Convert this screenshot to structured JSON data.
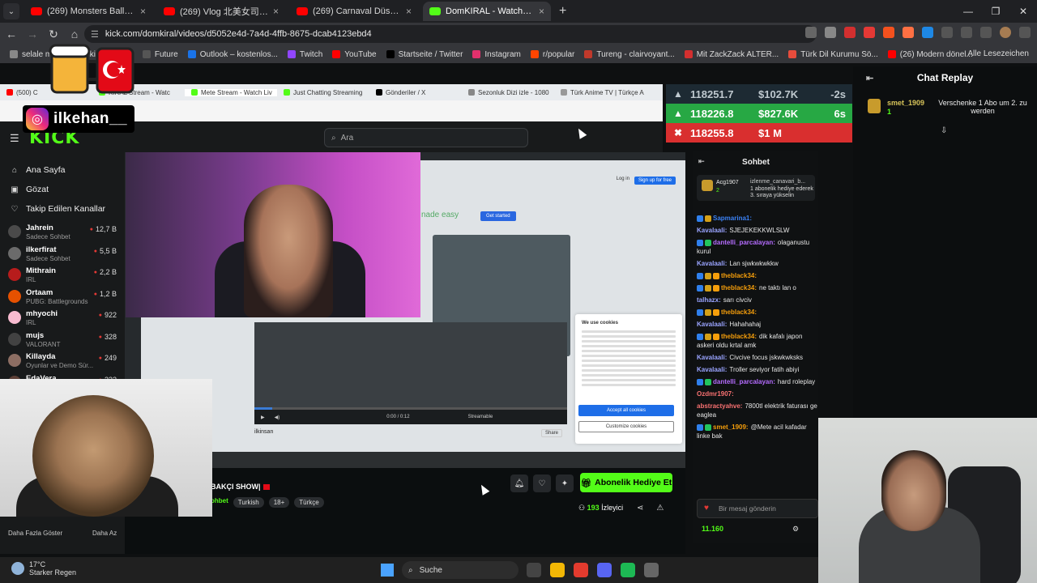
{
  "browser": {
    "tabs": [
      {
        "label": "(269) Monsters Ball: Bram vs. Al",
        "color": "#ff0000",
        "active": false
      },
      {
        "label": "(269) Vlog 北美女司机 工作＋生",
        "color": "#ff0000",
        "active": false
      },
      {
        "label": "(269) Carnaval Düsseldorf 2025",
        "color": "#ff0000",
        "active": false
      },
      {
        "label": "DomKIRAL - Watch the VO",
        "color": "#53fc18",
        "active": true
      }
    ],
    "url": "kick.com/domkiral/videos/d5052e4d-7a4d-4ffb-8675-dcab4123ebd4",
    "bookmarks": [
      {
        "label": "selale moruk",
        "color": "#888"
      },
      {
        "label": "ki",
        "color": "#555"
      },
      {
        "label": "idee",
        "color": "#555"
      },
      {
        "label": "Future",
        "color": "#555"
      },
      {
        "label": "Outlook – kostenlos...",
        "color": "#1a73e8"
      },
      {
        "label": "Twitch",
        "color": "#9146ff"
      },
      {
        "label": "YouTube",
        "color": "#ff0000"
      },
      {
        "label": "Startseite / Twitter",
        "color": "#000000"
      },
      {
        "label": "Instagram",
        "color": "#e1306c"
      },
      {
        "label": "r/popular",
        "color": "#ff4500"
      },
      {
        "label": "Tureng - clairvoyant...",
        "color": "#c0392b"
      },
      {
        "label": "Mit ZackZack ALTER...",
        "color": "#d32f2f"
      },
      {
        "label": "Türk Dil Kurumu Sö...",
        "color": "#e74c3c"
      },
      {
        "label": "(26) Modern dönel...",
        "color": "#ff0000"
      }
    ],
    "all_bookmarks": "Alle Lesezeichen"
  },
  "inner_browser": {
    "tabs": [
      {
        "label": "(500) C",
        "color": "#ff0000"
      },
      {
        "label": "KIRAL Stream - Watc",
        "color": "#53fc18"
      },
      {
        "label": "Mete Stream - Watch Liv",
        "color": "#53fc18"
      },
      {
        "label": "Just Chatting Streaming",
        "color": "#53fc18"
      },
      {
        "label": "Gönderiler / X",
        "color": "#000000"
      },
      {
        "label": "Sezonluk Dizi izle - 1080",
        "color": "#888888"
      },
      {
        "label": "Türk Anime TV | Türkçe A",
        "color": "#999999"
      }
    ]
  },
  "kick": {
    "logo": "KICK",
    "search_placeholder": "Ara",
    "nav": [
      {
        "label": "Ana Sayfa",
        "icon": "home-icon"
      },
      {
        "label": "Gözat",
        "icon": "browse-icon"
      },
      {
        "label": "Takip Edilen Kanallar",
        "icon": "heart-icon"
      }
    ],
    "channels": [
      {
        "name": "Jahrein",
        "sub": "Sadece Sohbet",
        "viewers": "12,7 B",
        "color": "#4a4a4a"
      },
      {
        "name": "ilkerfirat",
        "sub": "Sadece Sohbet",
        "viewers": "5,5 B",
        "color": "#6b6b6b"
      },
      {
        "name": "Mithrain",
        "sub": "IRL",
        "viewers": "2,2 B",
        "color": "#b71c1c"
      },
      {
        "name": "Ortaam",
        "sub": "PUBG: Battlegrounds",
        "viewers": "1,2 B",
        "color": "#e65100"
      },
      {
        "name": "mhyochi",
        "sub": "IRL",
        "viewers": "922",
        "color": "#f8bbd0"
      },
      {
        "name": "mujs",
        "sub": "VALORANT",
        "viewers": "328",
        "color": "#424242"
      },
      {
        "name": "Killayda",
        "sub": "Oyunlar ve Demo Sür...",
        "viewers": "249",
        "color": "#8d6e63"
      },
      {
        "name": "EdaVera",
        "sub": "",
        "viewers": "232",
        "color": "#5d4037"
      }
    ],
    "show_more": "Daha Fazla Göster",
    "show_less": "Daha Az",
    "stream_title": "BAKÇI SHOW|",
    "category": "ohbet",
    "tags": [
      "Turkish",
      "18+",
      "Türkçe"
    ],
    "subscribe_button": "Abonelik Hediye Et",
    "viewer_count": "193",
    "viewer_label": "İzleyici",
    "video": {
      "login": "Log in",
      "signup": "Sign up for free",
      "made_easy": "nade easy",
      "get_started": "Get started",
      "video_name": "ilkinsan",
      "share": "Share",
      "player_time": "0:00 / 0:12",
      "streamable": "Streamable",
      "cookie_title": "We use cookies",
      "cookie_accept": "Accept all cookies",
      "cookie_customize": "Customize cookies"
    }
  },
  "inner_chat": {
    "title": "Sohbet",
    "pinned": {
      "user": "Acg1907",
      "count": "2",
      "gift_user": "izlenme_canavari_b...",
      "gift_count": "1",
      "gift_text": "1 abonelik hediye ederek 3. sıraya yükselin"
    },
    "messages": [
      {
        "user": "Sapmarina1:",
        "text": "",
        "color": "#3b82f6",
        "badges": [
          "#2f80ed",
          "#d4a017"
        ]
      },
      {
        "user": "Kavalaali:",
        "text": "SJEJEKEKKWLSLW",
        "color": "#9aa4ff",
        "badges": []
      },
      {
        "user": "dantelli_parcalayan:",
        "text": "olaganustu kurul",
        "color": "#b56cff",
        "badges": [
          "#2f80ed",
          "#22c55e"
        ]
      },
      {
        "user": "Kavalaali:",
        "text": "Lan sjwkwkwkkw",
        "color": "#9aa4ff",
        "badges": []
      },
      {
        "user": "theblack34:",
        "text": "",
        "color": "#f59e0b",
        "badges": [
          "#2f80ed",
          "#d4a017",
          "#f59e0b"
        ]
      },
      {
        "user": "theblack34:",
        "text": "ne taktı lan o",
        "color": "#f59e0b",
        "badges": [
          "#2f80ed",
          "#d4a017",
          "#f59e0b"
        ]
      },
      {
        "user": "talhazx:",
        "text": "sarı civciv",
        "color": "#9aa4ff",
        "badges": []
      },
      {
        "user": "theblack34:",
        "text": "",
        "color": "#f59e0b",
        "badges": [
          "#2f80ed",
          "#d4a017",
          "#f59e0b"
        ]
      },
      {
        "user": "Kavalaali:",
        "text": "Hahahahaj",
        "color": "#9aa4ff",
        "badges": []
      },
      {
        "user": "theblack34:",
        "text": "dik kafalı japon askeri oldu krtal amk",
        "color": "#f59e0b",
        "badges": [
          "#2f80ed",
          "#d4a017",
          "#f59e0b"
        ]
      },
      {
        "user": "Kavalaali:",
        "text": "Civcive focus jskwkwksks",
        "color": "#9aa4ff",
        "badges": []
      },
      {
        "user": "Kavalaali:",
        "text": "Troller seviyor fatih abiyi",
        "color": "#9aa4ff",
        "badges": []
      },
      {
        "user": "dantelli_parcalayan:",
        "text": "hard roleplay",
        "color": "#b56cff",
        "badges": [
          "#2f80ed",
          "#22c55e"
        ]
      },
      {
        "user": "Ozdmr1907:",
        "text": "",
        "color": "#f87171",
        "badges": []
      },
      {
        "user": "abstractyahve:",
        "text": "7800tl elektrik faturası ge eaglea",
        "color": "#f87171",
        "badges": []
      },
      {
        "user": "smet_1909:",
        "text": "@Mete acil kafadar linke bak",
        "color": "#f59e0b",
        "badges": [
          "#2f80ed",
          "#22c55e"
        ]
      }
    ],
    "input_placeholder": "Bir mesaj gönderin",
    "points": "11.160"
  },
  "ticker": [
    {
      "icon": "up-icon",
      "price": "118251.7",
      "amount": "$102.7K",
      "time": "-2s"
    },
    {
      "icon": "up-icon",
      "price": "118226.8",
      "amount": "$827.6K",
      "time": "6s"
    },
    {
      "icon": "down-icon",
      "price": "118255.8",
      "amount": "$1 M",
      "time": ""
    }
  ],
  "replay": {
    "title": "Chat Replay",
    "pinned_user": "smet_1909",
    "pinned_count": "1",
    "pinned_message": "Verschenke 1 Abo um 2. zu werden"
  },
  "overlay": {
    "instagram_handle": "ilkehan__"
  },
  "windows": {
    "temp": "17°C",
    "weather": "Starker Regen",
    "search": "Suche",
    "apps": [
      "#444444",
      "#f2b705",
      "#e33b2e",
      "#5865f2",
      "#1db954",
      "#666666"
    ]
  }
}
